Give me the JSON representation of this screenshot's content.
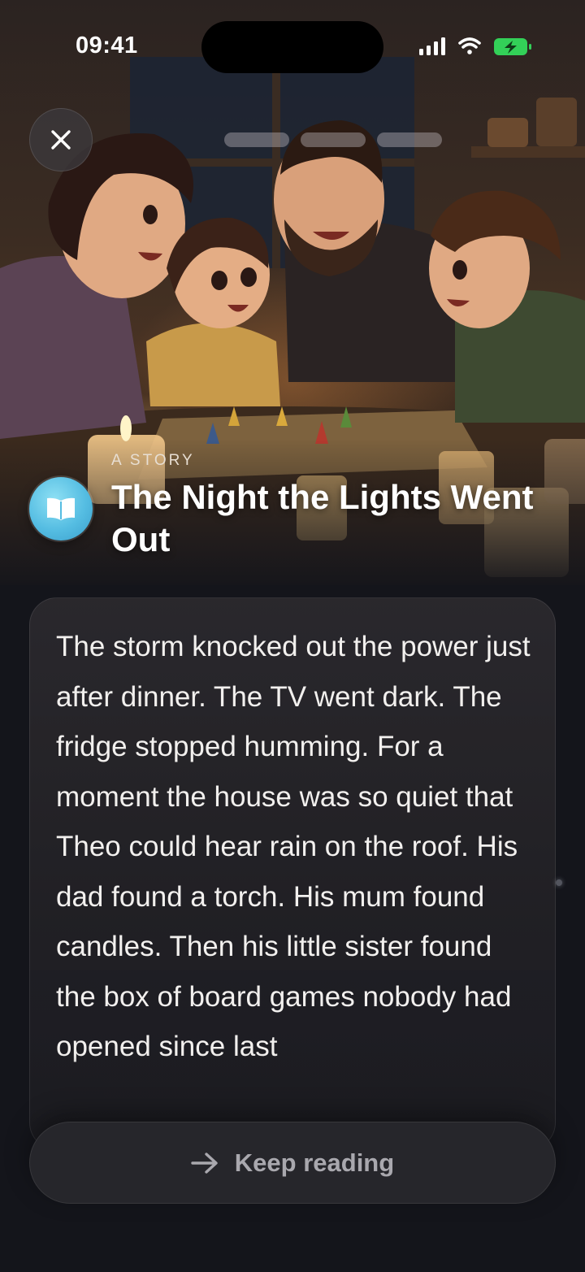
{
  "status_bar": {
    "time": "09:41"
  },
  "story": {
    "kicker": "A STORY",
    "title": "The Night the Lights Went Out",
    "body": "The storm knocked out the power just after dinner. The TV went dark. The fridge stopped humming. For a moment the house was so quiet that Theo could hear rain on the roof. His dad found a torch. His mum found candles. Then his little sister found the box of board games nobody had opened since last",
    "progress": {
      "segments": 3,
      "current": 1
    }
  },
  "actions": {
    "close_icon": "close-icon",
    "keep_reading_label": "Keep reading",
    "keep_reading_icon": "arrow-right-icon"
  },
  "colors": {
    "background": "#14151b",
    "card": "#26262b",
    "story_icon": "#55bde2",
    "battery": "#33d058"
  }
}
